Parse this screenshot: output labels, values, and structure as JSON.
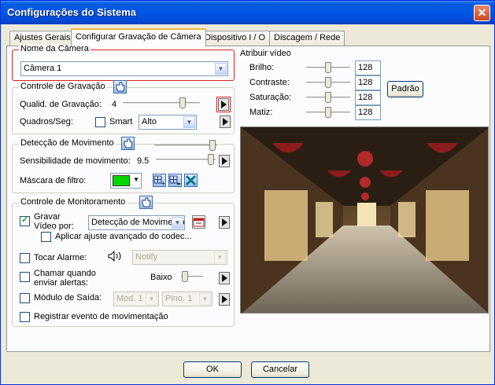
{
  "window": {
    "title": "Configurações do Sistema"
  },
  "tabs": [
    "Ajustes Gerais",
    "Configurar Gravação de Câmera",
    "Dispositivo I / O",
    "Discagem / Rede"
  ],
  "camera": {
    "group_label": "Nome da Câmera",
    "selected": "Câmera 1"
  },
  "recording": {
    "group_label": "Controle de Gravação",
    "quality_label": "Qualid. de Gravação:",
    "quality_value": "4",
    "quality_level": 4,
    "quality_max": 5,
    "fps_label": "Quadros/Seg:",
    "smart_label": "Smart",
    "smart_checked": false,
    "fps_selected": "Alto"
  },
  "motion": {
    "group_label": "Detecção de Movimento",
    "sensitivity_label": "Sensibilidade de movimento:",
    "sensitivity_value": "9.5",
    "mask_label": "Máscara de filtro:",
    "mask_color": "#00d800"
  },
  "monitoring": {
    "group_label": "Controle de Monitoramento",
    "record_video_label": "Gravar Vídeo por:",
    "record_video_checked": true,
    "record_video_selected": "Detecção de Movimento",
    "advanced_codec_label": "Aplicar ajuste avançado do codec...",
    "play_alarm_label": "Tocar Alarme:",
    "alarm_selected": "Notify",
    "send_alert_label": "Chamar quando enviar alertas:",
    "send_alert_level": "Baixo",
    "output_module_label": "Módulo de Saída:",
    "module_selected": "Mod. 1",
    "pin_selected": "Pino. 1",
    "register_event_label": "Registrar evento de movimentação"
  },
  "video": {
    "group_label": "Atribuir vídeo",
    "controls": [
      {
        "label": "Brilho:",
        "value": "128"
      },
      {
        "label": "Contraste:",
        "value": "128"
      },
      {
        "label": "Saturação:",
        "value": "128"
      },
      {
        "label": "Matiz:",
        "value": "128"
      }
    ],
    "default_button": "Padrão"
  },
  "buttons": {
    "ok": "OK",
    "cancel": "Cancelar"
  }
}
